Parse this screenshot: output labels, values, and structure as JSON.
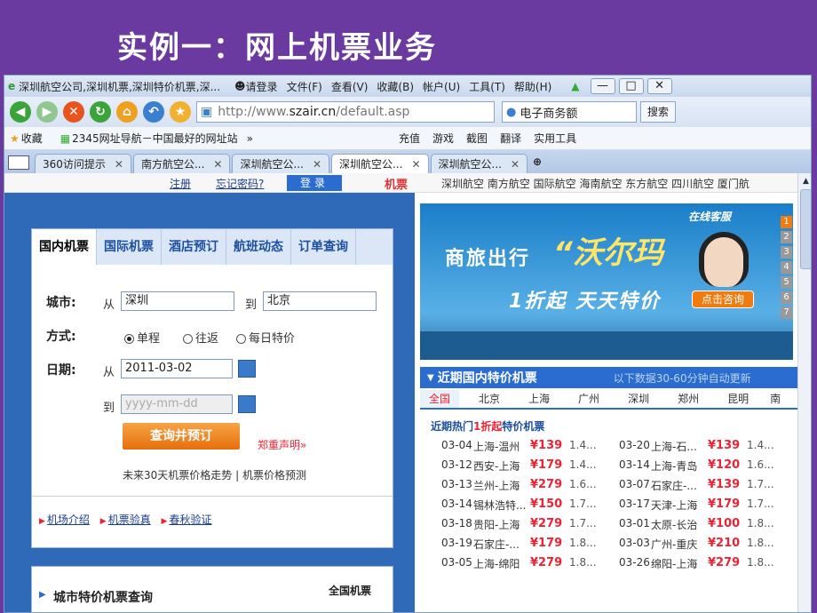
{
  "slide_title": "实例一：网上机票业务",
  "window": {
    "title": "深圳航空公司,深圳机票,深圳特价机票,深...",
    "login": "请登录",
    "menu": [
      "文件(F)",
      "查看(V)",
      "收藏(B)",
      "帐户(U)",
      "工具(T)",
      "帮助(H)"
    ]
  },
  "address": {
    "url_prefix": "http://www.",
    "url_host": "szair.cn",
    "url_path": "/default.asp",
    "search_text": "电子商务额",
    "search_button": "搜索"
  },
  "favbar": {
    "favorites": "收藏",
    "site": "2345网址导航－中国最好的网址站",
    "more": "»",
    "items": [
      "充值",
      "游戏",
      "截图",
      "翻译",
      "实用工具"
    ]
  },
  "tabs": [
    "360访问提示",
    "南方航空公...",
    "深圳航空公...",
    "深圳航空公...",
    "深圳航空公..."
  ],
  "top_strip": {
    "register": "注册",
    "forgot": "忘记密码?",
    "login_btn": "登录",
    "ticket_label": "机票",
    "airlines": "深圳航空 南方航空 国际航空 海南航空 东方航空 四川航空 厦门航"
  },
  "search": {
    "tabs": [
      "国内机票",
      "国际机票",
      "酒店预订",
      "航班动态",
      "订单查询"
    ],
    "city_label": "城市:",
    "from": "从",
    "from_value": "深圳",
    "to": "到",
    "to_value": "北京",
    "mode_label": "方式:",
    "modes": [
      "单程",
      "往返",
      "每日特价"
    ],
    "date_label": "日期:",
    "date_from": "从",
    "date_from_value": "2011-03-02",
    "date_to": "到",
    "date_to_placeholder": "yyyy-mm-dd",
    "submit": "查询并预订",
    "disclaimer": "郑重声明»",
    "trend": "未来30天机票价格走势 |  机票价格预测",
    "links": [
      "机场介绍",
      "机票验真",
      "春秋验证"
    ]
  },
  "citybox": {
    "title": "城市特价机票查询",
    "right": "全国机票"
  },
  "banner": {
    "line1": "商旅出行",
    "quote": "“沃尔玛",
    "line2": "1折起 天天特价",
    "svc_title": "在线客服",
    "svc_btn": "点击咨询",
    "nums": [
      "1",
      "2",
      "3",
      "4",
      "5",
      "6",
      "7"
    ]
  },
  "deals": {
    "title": "近期国内特价机票",
    "note": "以下数据30-60分钟自动更新",
    "city_tabs": [
      "全国",
      "北京",
      "上海",
      "广州",
      "深圳",
      "郑州",
      "昆明",
      "南"
    ],
    "hot_prefix": "近期热门",
    "hot_red": "1折起",
    "hot_suffix": "特价机票",
    "rows": [
      [
        [
          "03-04",
          "上海-温州",
          "¥139",
          "1.4..."
        ],
        [
          "03-20",
          "上海-石...",
          "¥139",
          "1.4..."
        ]
      ],
      [
        [
          "03-12",
          "西安-上海",
          "¥179",
          "1.4..."
        ],
        [
          "03-14",
          "上海-青岛",
          "¥120",
          "1.6..."
        ]
      ],
      [
        [
          "03-13",
          "兰州-上海",
          "¥279",
          "1.6..."
        ],
        [
          "03-07",
          "石家庄-...",
          "¥139",
          "1.7..."
        ]
      ],
      [
        [
          "03-14",
          "锡林浩特...",
          "¥150",
          "1.7..."
        ],
        [
          "03-17",
          "天津-上海",
          "¥179",
          "1.7..."
        ]
      ],
      [
        [
          "03-18",
          "贵阳-上海",
          "¥279",
          "1.7..."
        ],
        [
          "03-01",
          "太原-长治",
          "¥100",
          "1.8..."
        ]
      ],
      [
        [
          "03-19",
          "石家庄-...",
          "¥179",
          "1.8..."
        ],
        [
          "03-03",
          "广州-重庆",
          "¥210",
          "1.8..."
        ]
      ],
      [
        [
          "03-05",
          "上海-绵阳",
          "¥279",
          "1.8..."
        ],
        [
          "03-26",
          "绵阳-上海",
          "¥279",
          "1.8..."
        ]
      ]
    ]
  },
  "colors": {
    "slide_bg": "#6b3aa0",
    "accent_blue": "#2a6ccf",
    "price_red": "#e22233",
    "orange": "#f07c10"
  }
}
